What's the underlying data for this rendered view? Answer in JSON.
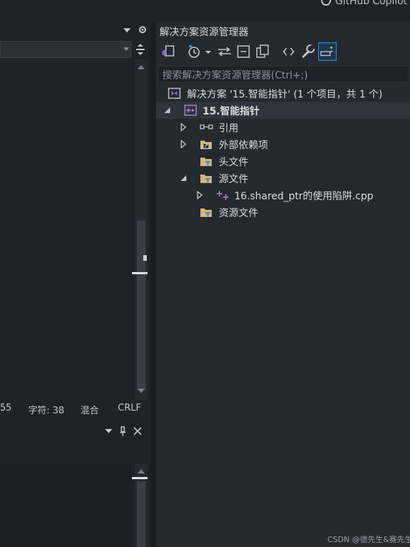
{
  "window": {
    "top_right_title": "GitHub Copilot"
  },
  "editor": {
    "status": {
      "line_tail": "55",
      "char_label": "字符: 38",
      "mix_label": "混合",
      "eol_label": "CRLF"
    }
  },
  "solution_explorer": {
    "title": "解决方案资源管理器",
    "search_placeholder": "搜索解决方案资源管理器(Ctrl+;)",
    "solution_label": "解决方案 '15.智能指针' (1 个项目，共 1 个)",
    "project_label": "15.智能指针",
    "items": {
      "references": "引用",
      "external_deps": "外部依赖项",
      "headers": "头文件",
      "sources": "源文件",
      "source_file": "16.shared_ptr的使用陷阱.cpp",
      "resources": "资源文件"
    }
  },
  "watermark": "CSDN @德先生&赛先生",
  "colors": {
    "accent": "#3794d1",
    "folder": "#dcb67a",
    "project": "#b180d7",
    "panel_bg": "#252930"
  }
}
